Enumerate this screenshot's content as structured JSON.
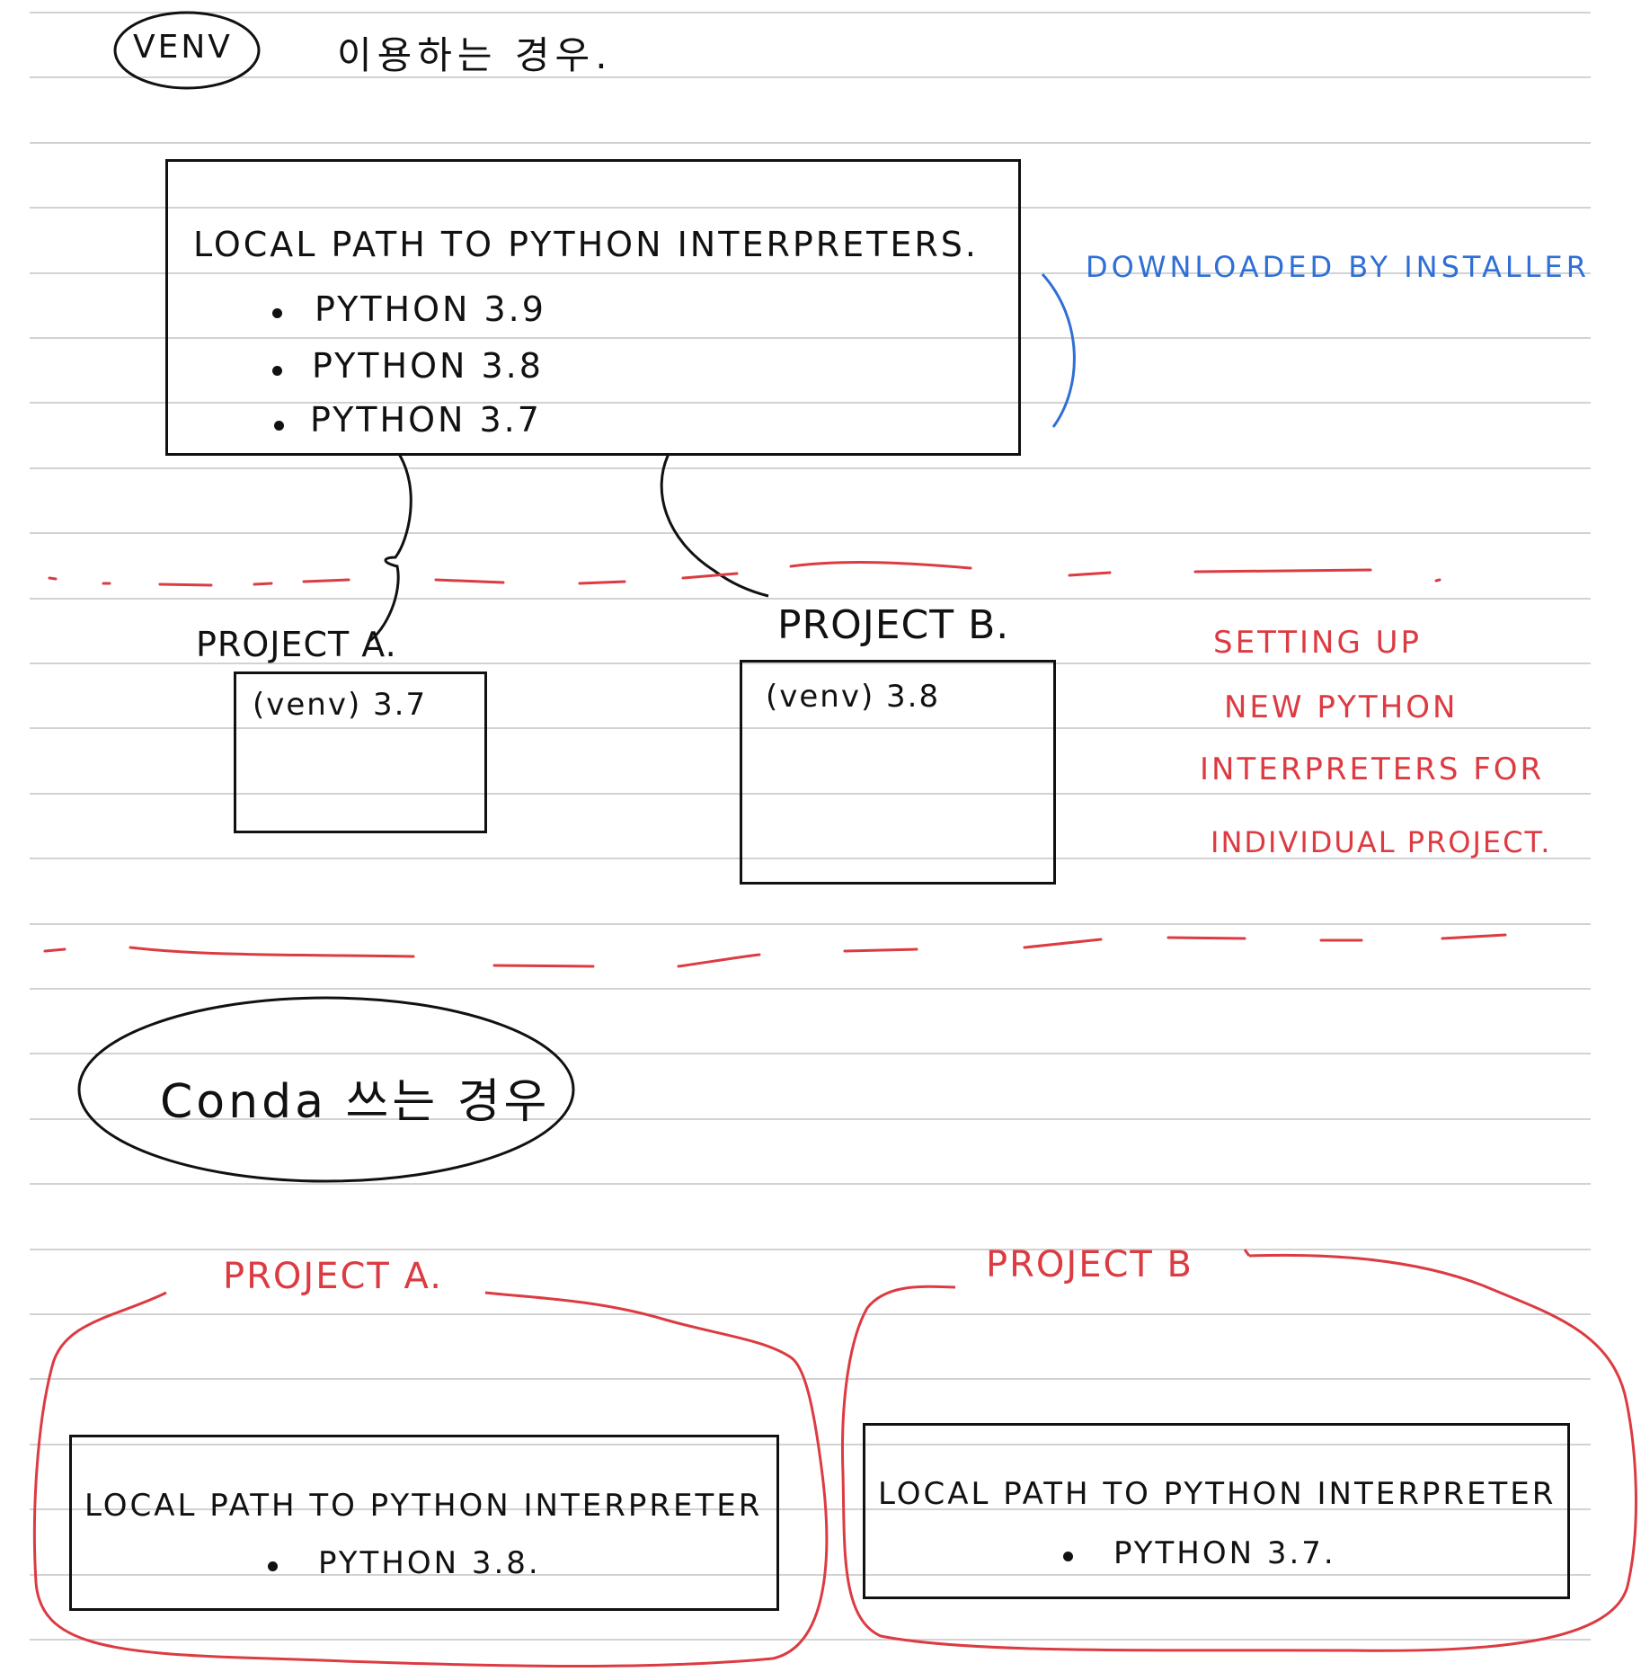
{
  "colors": {
    "ink": "#111111",
    "blue": "#2f6fd6",
    "red": "#dc3b42",
    "rule": "#d2d2d2"
  },
  "venv_section": {
    "badge": "VENV",
    "heading": "이용하는 경우.",
    "interpreters_box": {
      "title": "LOCAL PATH TO PYTHON INTERPRETERS.",
      "items": [
        "PYTHON 3.9",
        "PYTHON 3.8",
        "PYTHON 3.7"
      ]
    },
    "installer_note": "DOWNLOADED BY INSTALLER",
    "project_a": {
      "label": "PROJECT A.",
      "env": "(venv) 3.7"
    },
    "project_b": {
      "label": "PROJECT B.",
      "env": "(venv) 3.8"
    },
    "setup_note": [
      "SETTING UP",
      "NEW PYTHON",
      "INTERPRETERS FOR",
      "INDIVIDUAL PROJECT."
    ]
  },
  "conda_section": {
    "heading": "Conda 쓰는 경우",
    "project_a": {
      "label": "PROJECT A.",
      "box_title": "LOCAL PATH TO PYTHON INTERPRETER",
      "item": "PYTHON 3.8."
    },
    "project_b": {
      "label": "PROJECT B",
      "box_title": "LOCAL PATH TO PYTHON INTERPRETER",
      "item": "PYTHON 3.7."
    }
  }
}
